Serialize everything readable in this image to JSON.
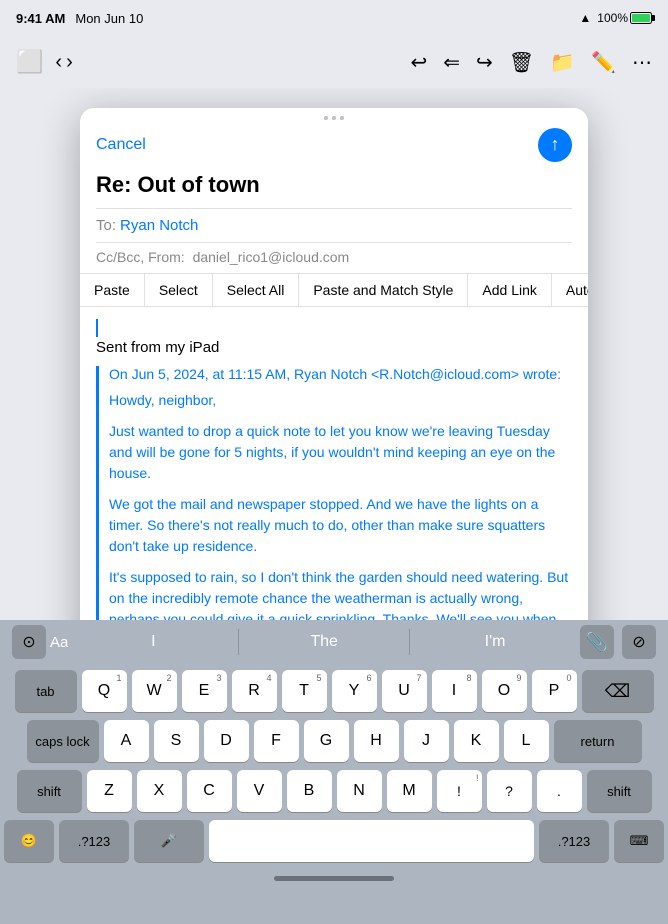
{
  "statusBar": {
    "time": "9:41 AM",
    "date": "Mon Jun 10",
    "wifi": "wifi",
    "battery": "100%"
  },
  "toolbar": {
    "icons": [
      "sidebar",
      "chevron-up",
      "chevron-down",
      "reply",
      "reply-all",
      "forward",
      "trash",
      "folder",
      "compose",
      "more"
    ]
  },
  "compose": {
    "cancel": "Cancel",
    "subject": "Re: Out of town",
    "to_label": "To:",
    "to_name": "Ryan Notch",
    "cc_label": "Cc/Bcc, From:",
    "cc_value": "daniel_rico1@icloud.com",
    "contextMenu": {
      "paste": "Paste",
      "select": "Select",
      "selectAll": "Select All",
      "pasteMatch": "Paste and Match Style",
      "addLink": "Add Link",
      "autoFill": "AutoFill"
    },
    "body": {
      "cursor": true,
      "sentFrom": "Sent from my iPad",
      "quoted": {
        "header": "On Jun 5, 2024, at 11:15 AM, Ryan Notch <R.Notch@icloud.com> wrote:",
        "paragraphs": [
          "Howdy, neighbor,",
          "Just wanted to drop a quick note to let you know we're leaving Tuesday and will be gone for 5 nights, if you wouldn't mind keeping an eye on the house.",
          "We got the mail and newspaper stopped. And we have the lights on a timer. So there's not really much to do, other than make sure squatters don't take up residence.",
          "It's supposed to rain, so I don't think the garden should need watering. But on the incredibly remote chance the weatherman is actually wrong, perhaps you could give it a quick sprinkling. Thanks. We'll see you when we get back!"
        ]
      }
    }
  },
  "predictive": {
    "words": [
      "I",
      "The",
      "I'm"
    ]
  },
  "keyboard": {
    "row1": [
      "Q",
      "W",
      "E",
      "R",
      "T",
      "Y",
      "U",
      "I",
      "O",
      "P"
    ],
    "row1_nums": [
      "1",
      "2",
      "3",
      "4",
      "5",
      "6",
      "7",
      "8",
      "9",
      "0"
    ],
    "row2": [
      "A",
      "S",
      "D",
      "F",
      "G",
      "H",
      "J",
      "K",
      "L"
    ],
    "row3": [
      "Z",
      "X",
      "C",
      "V",
      "B",
      "N",
      "M"
    ],
    "special": {
      "tab": "tab",
      "caps": "caps lock",
      "return": "return",
      "shift_l": "shift",
      "shift_r": "shift",
      "delete": "⌫",
      "emoji": "😊",
      "num": ".?123",
      "mic": "🎤",
      "num_r": ".?123",
      "keyboard": "⌨"
    }
  }
}
